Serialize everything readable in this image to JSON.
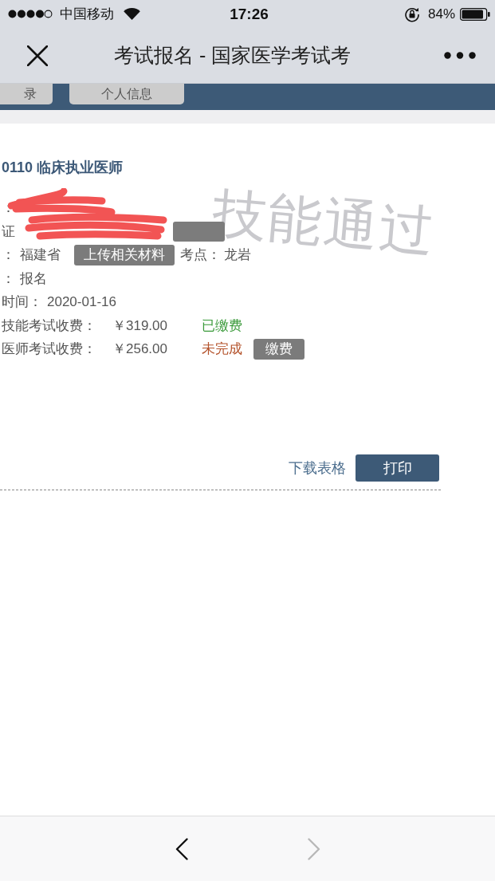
{
  "status_bar": {
    "carrier": "中国移动",
    "time": "17:26",
    "battery": "84%"
  },
  "nav_bar": {
    "title": "考试报名 - 国家医学考试考"
  },
  "tabs": [
    {
      "label": "录",
      "selected": false
    },
    {
      "label": "个人信息",
      "selected": false
    }
  ],
  "registration": {
    "title": "0110 临床执业医师",
    "stamp": "技能通过",
    "rows": [
      {
        "kind": "redacted",
        "label": "："
      },
      {
        "kind": "redacted",
        "label": "证",
        "covered_button": true
      },
      {
        "kind": "field",
        "label": "：",
        "value": "福建省",
        "button": "上传相关材料",
        "extra_label": "考点：",
        "extra_value": "龙岩"
      },
      {
        "kind": "field",
        "label": "：",
        "value": "报名"
      },
      {
        "kind": "field",
        "label": "时间：",
        "value": "2020-01-16"
      },
      {
        "kind": "fee",
        "label": "技能考试收费：",
        "value": "￥319.00",
        "status": "已缴费",
        "paid": true
      },
      {
        "kind": "fee",
        "label": "医师考试收费：",
        "value": "￥256.00",
        "status": "未完成",
        "paid": false,
        "button": "缴费"
      }
    ]
  },
  "actions": {
    "link": "下载表格",
    "button": "打印"
  },
  "toolbar": [
    {
      "kind": "back",
      "disabled": false
    },
    {
      "kind": "forward",
      "disabled": true
    }
  ]
}
